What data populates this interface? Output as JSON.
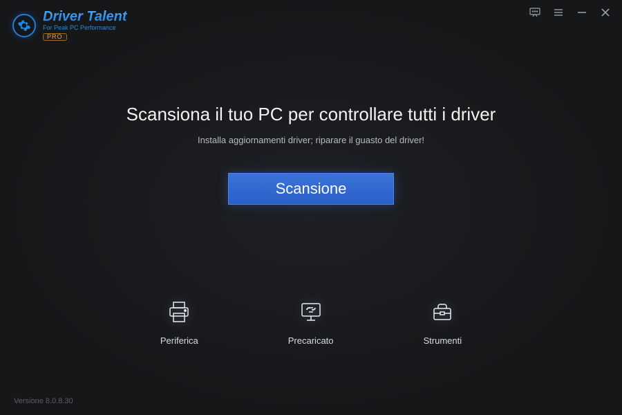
{
  "app": {
    "title": "Driver Talent",
    "tagline": "For Peak PC Performance",
    "edition": "PRO"
  },
  "titlebar": {
    "feedback": "feedback",
    "menu": "menu",
    "minimize": "minimize",
    "close": "close"
  },
  "main": {
    "headline": "Scansiona il tuo PC per controllare tutti i driver",
    "sub": "Installa aggiornamenti driver; riparare il guasto del driver!",
    "scan_label": "Scansione"
  },
  "actions": {
    "peripheral": {
      "label": "Periferica"
    },
    "preloaded": {
      "label": "Precaricato"
    },
    "tools": {
      "label": "Strumenti"
    }
  },
  "footer": {
    "version": "Versione 8.0.8.30"
  }
}
